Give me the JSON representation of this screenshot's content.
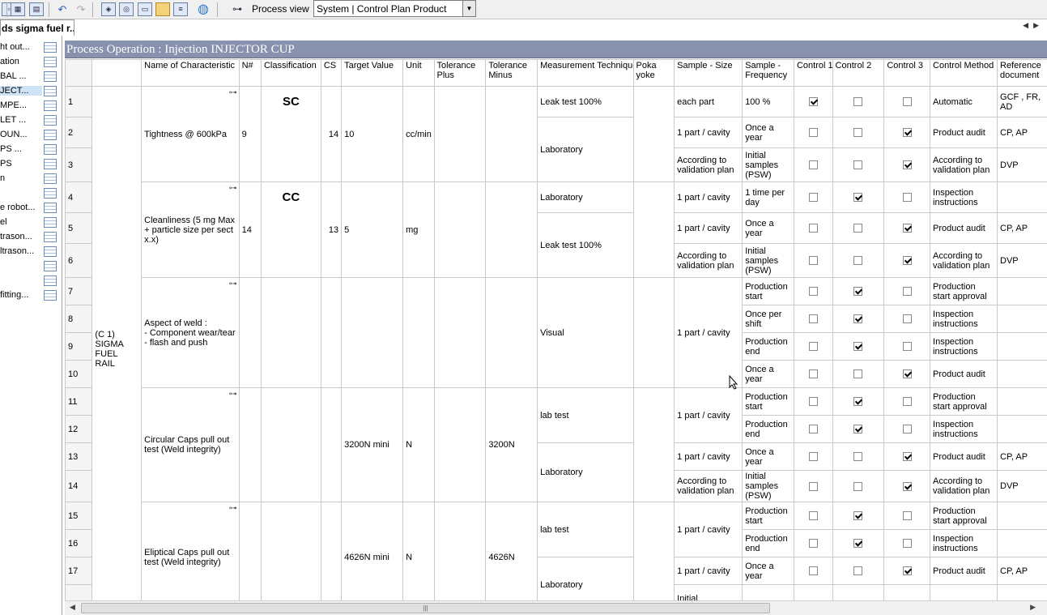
{
  "toolbar": {
    "process_view_label": "Process view",
    "system_combo_value": "System  |  Control Plan Product"
  },
  "left_panel": {
    "tab_title": "ds sigma fuel r...",
    "items": [
      {
        "label": "ht out..."
      },
      {
        "label": "ation"
      },
      {
        "label": "BAL ..."
      },
      {
        "label": "JECT...",
        "selected": true
      },
      {
        "label": "MPE..."
      },
      {
        "label": "LET ..."
      },
      {
        "label": "OUN..."
      },
      {
        "label": "PS ..."
      },
      {
        "label": "PS"
      },
      {
        "label": "n"
      },
      {
        "label": ""
      },
      {
        "label": "e robot..."
      },
      {
        "label": "el"
      },
      {
        "label": "trason..."
      },
      {
        "label": "ltrason..."
      },
      {
        "label": ""
      },
      {
        "label": ""
      },
      {
        "label": " fitting..."
      }
    ]
  },
  "operation_header": "Process Operation : Injection INJECTOR CUP",
  "columns": {
    "characteristic": "Name of Characteristic",
    "n": "N#",
    "classification": "Classification",
    "cs": "CS",
    "target": "Target Value",
    "unit": "Unit",
    "tol_plus": "Tolerance Plus",
    "tol_minus": "Tolerance Minus",
    "measurement": "Measurement Technique",
    "poka": "Poka yoke",
    "sample_size": "Sample - Size",
    "sample_freq": "Sample - Frequency",
    "control1": "Control 1",
    "control2": "Control 2",
    "control3": "Control 3",
    "control_method": "Control Method",
    "reference": "Reference document"
  },
  "part_label": "(C 1) SIGMA FUEL RAIL",
  "characteristics": [
    {
      "name": "Tightness @ 600kPa",
      "n": "9",
      "classification": "SC",
      "cs": "14",
      "target": "10",
      "unit": "cc/min",
      "tol_minus": ""
    },
    {
      "name": "Cleanliness (5 mg Max + particle size per sect x.x)",
      "n": "14",
      "classification": "CC",
      "cs": "13",
      "target": "5",
      "unit": "mg",
      "tol_minus": ""
    },
    {
      "name": "Aspect of weld :\n- Component wear/tear\n- flash and push",
      "n": "",
      "classification": "",
      "cs": "",
      "target": "",
      "unit": "",
      "tol_minus": ""
    },
    {
      "name": "Circular Caps pull out test (Weld integrity)",
      "n": "",
      "classification": "",
      "cs": "",
      "target": "3200N mini",
      "unit": "N",
      "tol_minus": "3200N"
    },
    {
      "name": "Eliptical Caps pull out test (Weld integrity)",
      "n": "",
      "classification": "",
      "cs": "",
      "target": "4626N mini",
      "unit": "N",
      "tol_minus": "4626N"
    }
  ],
  "measurements": [
    "Leak test 100%",
    "Laboratory",
    "Laboratory",
    "Leak test 100%",
    "Visual",
    "lab test",
    "Laboratory",
    "lab test",
    "Laboratory"
  ],
  "sample_sizes": [
    "each part",
    "1 part / cavity",
    "According to validation plan",
    "1 part / cavity",
    "1 part / cavity",
    "According to validation plan",
    "1 part / cavity",
    "1 part / cavity",
    "1 part / cavity",
    "According to validation plan",
    "1 part / cavity",
    "1 part / cavity"
  ],
  "rows": [
    {
      "n": "1",
      "freq": "100 %",
      "c1": true,
      "c2": false,
      "c3": false,
      "method": "Automatic",
      "ref": "GCF ,  FR, AD"
    },
    {
      "n": "2",
      "freq": "Once a year",
      "c1": false,
      "c2": false,
      "c3": true,
      "method": "Product audit",
      "ref": "CP, AP"
    },
    {
      "n": "3",
      "freq": "Initial samples (PSW)",
      "c1": false,
      "c2": false,
      "c3": true,
      "method": "According to validation plan",
      "ref": "DVP"
    },
    {
      "n": "4",
      "freq": "1 time per day",
      "c1": false,
      "c2": true,
      "c3": false,
      "method": "Inspection instructions",
      "ref": ""
    },
    {
      "n": "5",
      "freq": "Once a year",
      "c1": false,
      "c2": false,
      "c3": true,
      "method": "Product audit",
      "ref": "CP, AP"
    },
    {
      "n": "6",
      "freq": "Initial samples (PSW)",
      "c1": false,
      "c2": false,
      "c3": true,
      "method": "According to validation plan",
      "ref": "DVP"
    },
    {
      "n": "7",
      "freq": "Production start",
      "c1": false,
      "c2": true,
      "c3": false,
      "method": "Production start approval",
      "ref": ""
    },
    {
      "n": "8",
      "freq": "Once per shift",
      "c1": false,
      "c2": true,
      "c3": false,
      "method": "Inspection instructions",
      "ref": ""
    },
    {
      "n": "9",
      "freq": "Production end",
      "c1": false,
      "c2": true,
      "c3": false,
      "method": "Inspection instructions",
      "ref": ""
    },
    {
      "n": "10",
      "freq": "Once a year",
      "c1": false,
      "c2": false,
      "c3": true,
      "method": "Product audit",
      "ref": ""
    },
    {
      "n": "11",
      "freq": "Production start",
      "c1": false,
      "c2": true,
      "c3": false,
      "method": "Production start approval",
      "ref": ""
    },
    {
      "n": "12",
      "freq": "Production end",
      "c1": false,
      "c2": true,
      "c3": false,
      "method": "Inspection instructions",
      "ref": ""
    },
    {
      "n": "13",
      "freq": "Once a year",
      "c1": false,
      "c2": false,
      "c3": true,
      "method": "Product audit",
      "ref": "CP, AP"
    },
    {
      "n": "14",
      "freq": "Initial samples (PSW)",
      "c1": false,
      "c2": false,
      "c3": true,
      "method": "According to validation plan",
      "ref": "DVP"
    },
    {
      "n": "15",
      "freq": "Production start",
      "c1": false,
      "c2": true,
      "c3": false,
      "method": "Production start approval",
      "ref": ""
    },
    {
      "n": "16",
      "freq": "Production end",
      "c1": false,
      "c2": true,
      "c3": false,
      "method": "Inspection instructions",
      "ref": ""
    },
    {
      "n": "17",
      "freq": "Once a year",
      "c1": false,
      "c2": false,
      "c3": true,
      "method": "Product audit",
      "ref": "CP, AP"
    },
    {
      "n": "",
      "freq": "Initial",
      "c1": null,
      "c2": null,
      "c3": null,
      "method": "",
      "ref": ""
    }
  ]
}
